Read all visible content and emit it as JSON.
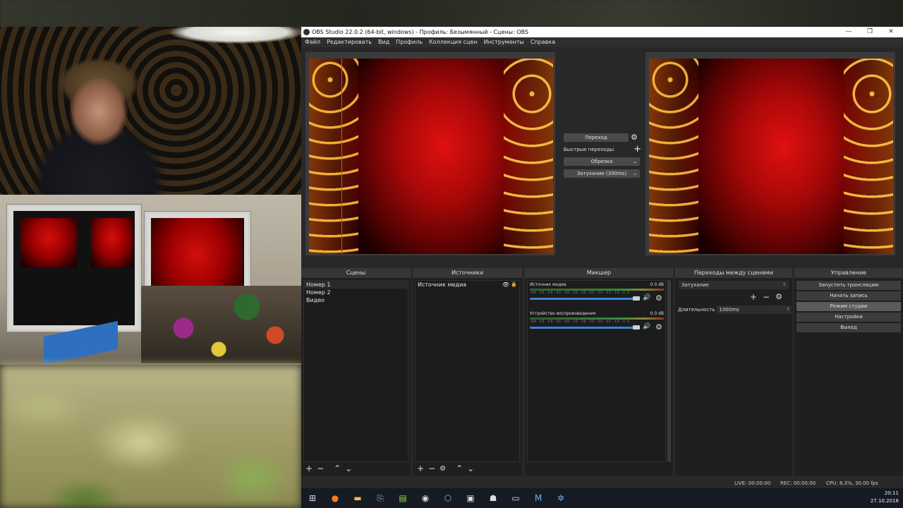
{
  "window": {
    "title": "OBS Studio 22.0.2 (64-bit, windows) - Профиль: Безымянный - Сцены: OBS",
    "controls": {
      "minimize": "—",
      "restore": "❐",
      "close": "✕"
    }
  },
  "menu": [
    "Файл",
    "Редактировать",
    "Вид",
    "Профиль",
    "Коллекция сцен",
    "Инструменты",
    "Справка"
  ],
  "transition_panel": {
    "transition_button": "Переход",
    "quick_transitions_label": "Быстрые переходы",
    "cut_label": "Обрезка",
    "fade_label": "Затухание (300ms)"
  },
  "scenes": {
    "header": "Сцены",
    "items": [
      "Номер 1",
      "Номер 2",
      "Видео"
    ]
  },
  "sources": {
    "header": "Источники",
    "items": [
      "Источник медиа"
    ]
  },
  "mixer": {
    "header": "Микшер",
    "ticks": "-60 -55 -50 -45 -40 -35 -30 -25 -20 -15 -10 -5 0",
    "tracks": [
      {
        "name": "Источник медиа",
        "level": "0.0 dB"
      },
      {
        "name": "Устройство воспроизведения",
        "level": "0.0 dB"
      }
    ]
  },
  "scene_transitions": {
    "header": "Переходы между сценами",
    "selected": "Затухание",
    "duration_label": "Длительность",
    "duration_value": "1000ms"
  },
  "controls": {
    "header": "Управление",
    "buttons": [
      "Запустить трансляцию",
      "Начать запись",
      "Режим студии",
      "Настройки",
      "Выход"
    ]
  },
  "status": {
    "live": "LIVE: 00:00:00",
    "rec": "REC: 00:00:00",
    "cpu": "CPU: 8.3%, 30.00 fps"
  },
  "taskbar": {
    "time": "20:11",
    "date": "27.10.2018"
  },
  "colors": {
    "accent": "#3b83d6",
    "panel": "#1f1f1f",
    "header": "#363636",
    "preview_red": "#d40e0e"
  }
}
